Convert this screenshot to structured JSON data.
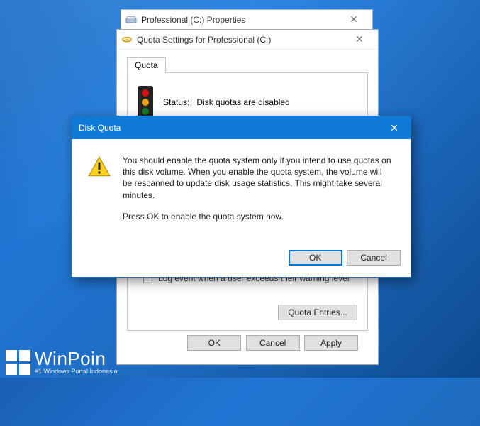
{
  "propertiesWindow": {
    "title": "Professional (C:) Properties"
  },
  "quotaSettingsWindow": {
    "title": "Quota Settings for Professional (C:)",
    "tabLabel": "Quota",
    "statusLabel": "Status:",
    "statusValue": "Disk quotas are disabled",
    "logEventLabel": "Log event when a user exceeds their warning level",
    "quotaEntriesButton": "Quota Entries...",
    "buttons": {
      "ok": "OK",
      "cancel": "Cancel",
      "apply": "Apply"
    }
  },
  "diskQuotaDialog": {
    "title": "Disk Quota",
    "message1": "You should enable the quota system only if you intend to use quotas on this disk volume.  When you enable the quota system, the volume will be rescanned to update disk usage statistics. This might take several minutes.",
    "message2": "Press OK to enable the quota system now.",
    "buttons": {
      "ok": "OK",
      "cancel": "Cancel"
    }
  },
  "watermark": {
    "brand": "WinPoin",
    "tagline": "#1 Windows Portal Indonesia"
  }
}
